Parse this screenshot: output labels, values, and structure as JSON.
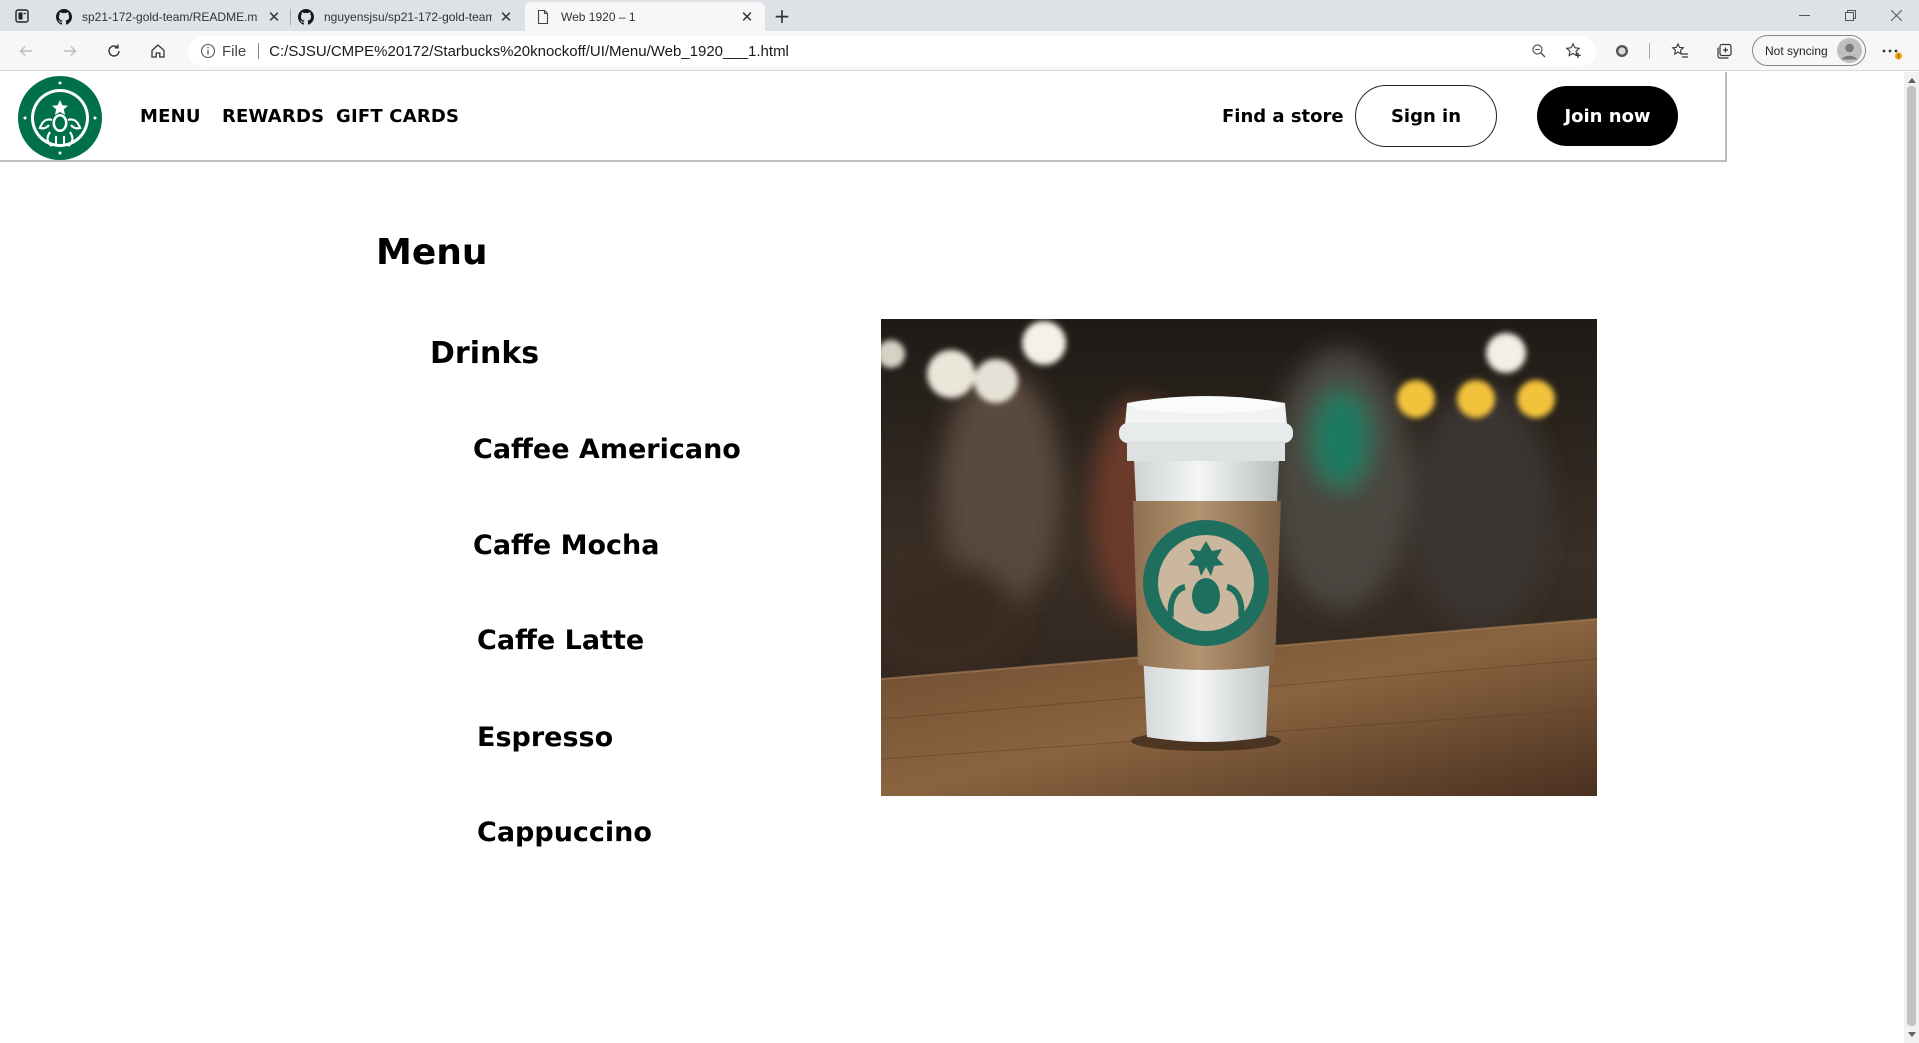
{
  "browser": {
    "tabs": [
      {
        "title": "sp21-172-gold-team/README.m",
        "icon": "github-icon",
        "active": false
      },
      {
        "title": "nguyensjsu/sp21-172-gold-team",
        "icon": "github-icon",
        "active": false
      },
      {
        "title": "Web 1920 – 1",
        "icon": "file-icon",
        "active": true
      }
    ],
    "address": {
      "scheme_label": "File",
      "url": "C:/SJSU/CMPE%20172/Starbucks%20knockoff/UI/Menu/Web_1920___1.html"
    },
    "sync_label": "Not syncing"
  },
  "site": {
    "nav": {
      "menu": "MENU",
      "rewards": "REWARDS",
      "gift_cards": "GIFT CARDS"
    },
    "find_store": "Find a store",
    "sign_in": "Sign in",
    "join_now": "Join now"
  },
  "content": {
    "title": "Menu",
    "section": "Drinks",
    "drinks": [
      "Caffee Americano",
      "Caffe Mocha",
      "Caffe Latte",
      "Espresso",
      "Cappuccino"
    ]
  },
  "colors": {
    "brand_green": "#00704a",
    "join_bg": "#000000",
    "text": "#000000"
  }
}
